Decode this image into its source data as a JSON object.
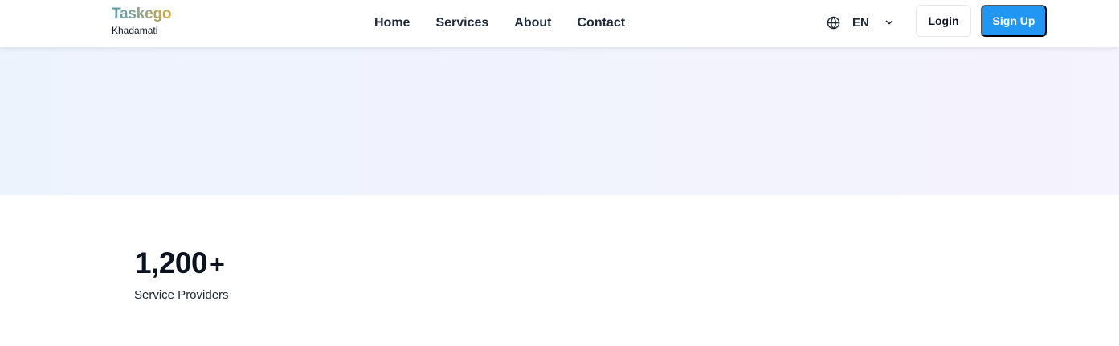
{
  "brand": {
    "name": "Taskego",
    "tagline": "Khadamati",
    "gradient_colors": [
      "#5b9bb0",
      "#8fa38a",
      "#d1a63a"
    ]
  },
  "nav": {
    "links": [
      {
        "label": "Home"
      },
      {
        "label": "Services"
      },
      {
        "label": "About"
      },
      {
        "label": "Contact"
      }
    ]
  },
  "language": {
    "selected": "EN",
    "icon": "globe-icon",
    "dropdown_icon": "chevron-down-icon"
  },
  "auth": {
    "login_label": "Login",
    "signup_label": "Sign Up"
  },
  "stats": [
    {
      "value": "1,200",
      "suffix": "+",
      "label": "Service Providers"
    }
  ],
  "colors": {
    "accent": "#2196f3",
    "hero_gradient": [
      "#edf3fd",
      "#f5f3fd"
    ],
    "text_dark": "#0b1220"
  }
}
